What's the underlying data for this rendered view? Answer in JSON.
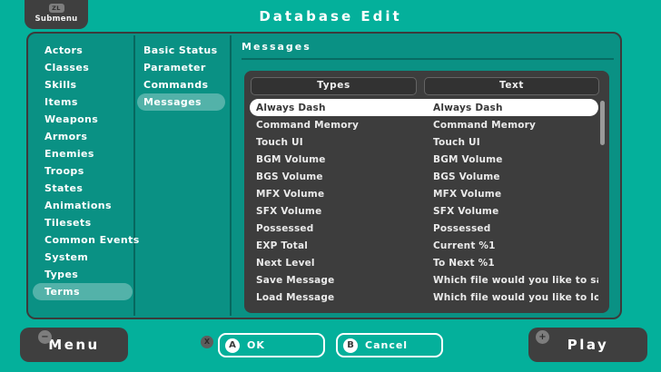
{
  "header": {
    "submenu_button": {
      "key": "ZL",
      "label": "Submenu"
    },
    "title": "Database Edit"
  },
  "sidebar": {
    "items": [
      "Actors",
      "Classes",
      "Skills",
      "Items",
      "Weapons",
      "Armors",
      "Enemies",
      "Troops",
      "States",
      "Animations",
      "Tilesets",
      "Common Events",
      "System",
      "Types",
      "Terms"
    ],
    "selected": "Terms"
  },
  "sections": {
    "items": [
      "Basic Status",
      "Parameter",
      "Commands",
      "Messages"
    ],
    "selected": "Messages"
  },
  "main": {
    "title": "Messages",
    "table": {
      "columns": [
        "Types",
        "Text"
      ],
      "rows": [
        {
          "type": "Always Dash",
          "text": "Always Dash",
          "selected": true
        },
        {
          "type": "Command Memory",
          "text": "Command Memory"
        },
        {
          "type": "Touch UI",
          "text": "Touch UI"
        },
        {
          "type": "BGM Volume",
          "text": "BGM Volume"
        },
        {
          "type": "BGS Volume",
          "text": "BGS Volume"
        },
        {
          "type": "MFX Volume",
          "text": "MFX Volume"
        },
        {
          "type": "SFX Volume",
          "text": "SFX Volume"
        },
        {
          "type": "Possessed",
          "text": "Possessed"
        },
        {
          "type": "EXP Total",
          "text": "Current %1"
        },
        {
          "type": "Next Level",
          "text": "To Next %1"
        },
        {
          "type": "Save Message",
          "text": "Which file would you like to save to?"
        },
        {
          "type": "Load Message",
          "text": "Which file would you like to load?"
        }
      ]
    }
  },
  "footer": {
    "menu_button": {
      "key": "−",
      "label": "Menu"
    },
    "x_badge": "X",
    "ok_button": {
      "key": "A",
      "label": "OK"
    },
    "cancel_button": {
      "key": "B",
      "label": "Cancel"
    },
    "play_button": {
      "key": "+",
      "label": "Play"
    }
  },
  "colors": {
    "background": "#04b09b",
    "panel": "#0a9184",
    "panel_border": "#3b3b3b",
    "dark_button": "#3f3f3f",
    "table": "#3d3d3d",
    "selected_row": "#ffffff",
    "highlight_pill": "#55b4a6"
  }
}
